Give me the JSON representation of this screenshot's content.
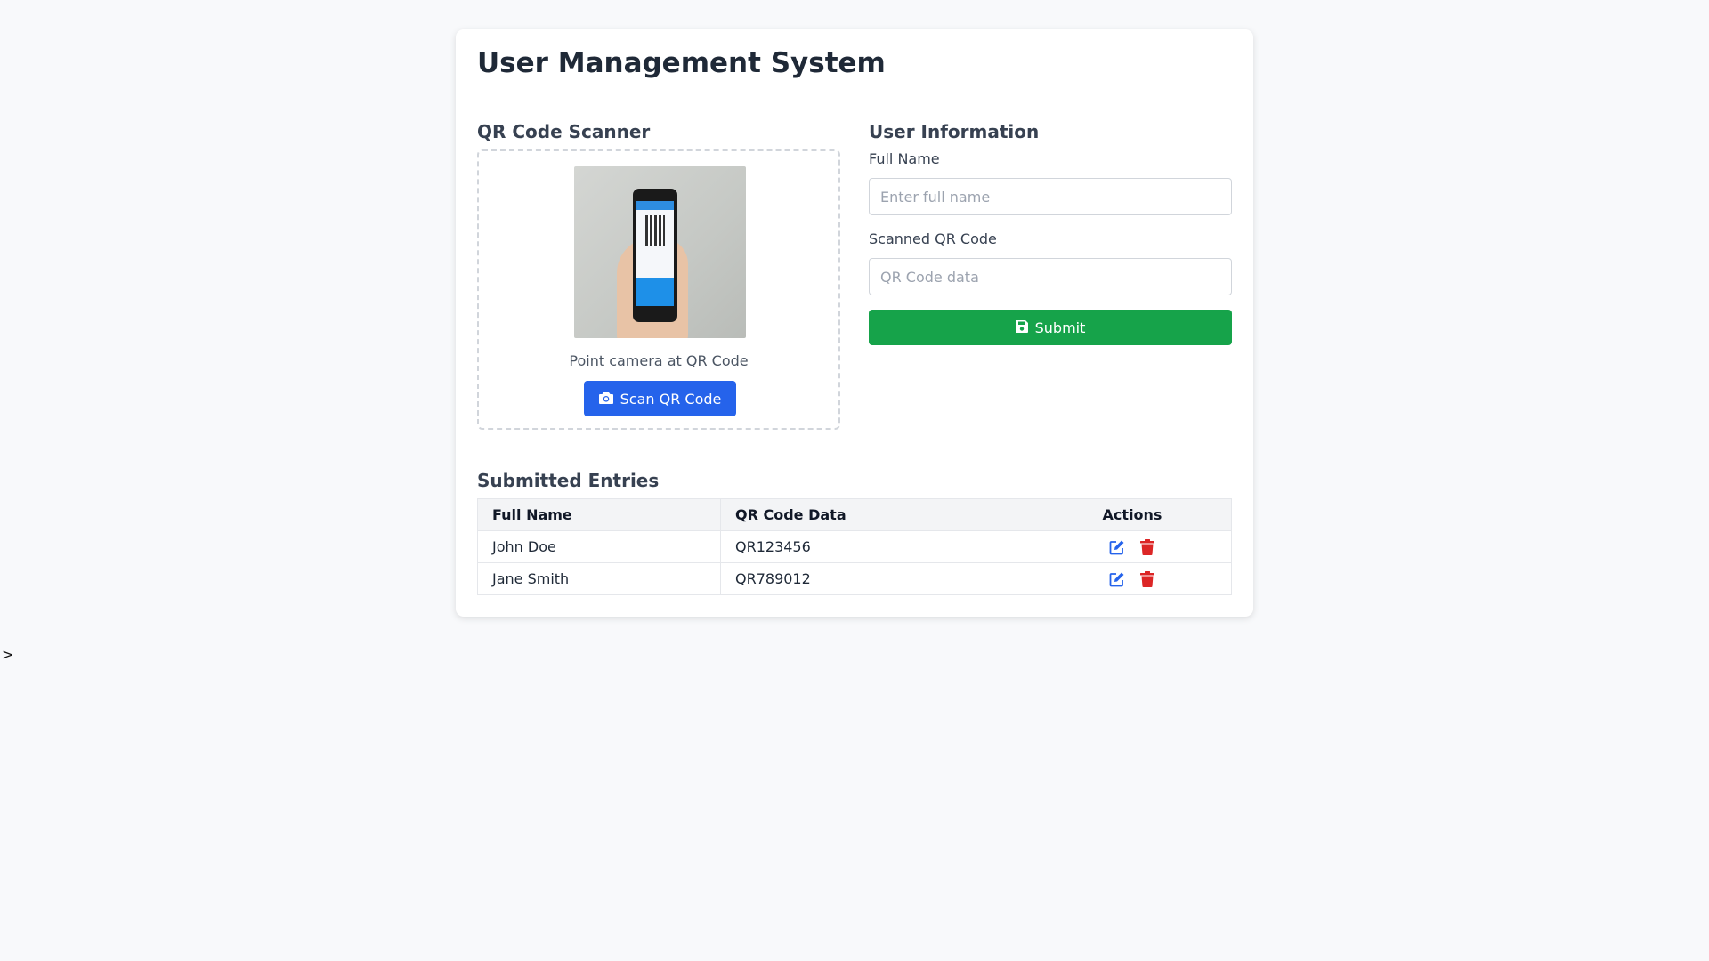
{
  "app": {
    "title": "User Management System"
  },
  "scanner": {
    "title": "QR Code Scanner",
    "hint": "Point camera at QR Code",
    "scan_button": "Scan QR Code"
  },
  "form": {
    "title": "User Information",
    "full_name_label": "Full Name",
    "full_name_placeholder": "Enter full name",
    "full_name_value": "",
    "qr_label": "Scanned QR Code",
    "qr_placeholder": "QR Code data",
    "qr_value": "",
    "submit_label": "Submit"
  },
  "entries": {
    "title": "Submitted Entries",
    "columns": [
      "Full Name",
      "QR Code Data",
      "Actions"
    ],
    "rows": [
      {
        "name": "John Doe",
        "qr": "QR123456"
      },
      {
        "name": "Jane Smith",
        "qr": "QR789012"
      }
    ]
  },
  "stray_text": ">",
  "colors": {
    "primary": "#2563eb",
    "success": "#16a34a",
    "danger": "#dc2626"
  },
  "icons": {
    "scan": "camera-icon",
    "submit": "save-icon",
    "edit": "edit-icon",
    "delete": "trash-icon"
  }
}
